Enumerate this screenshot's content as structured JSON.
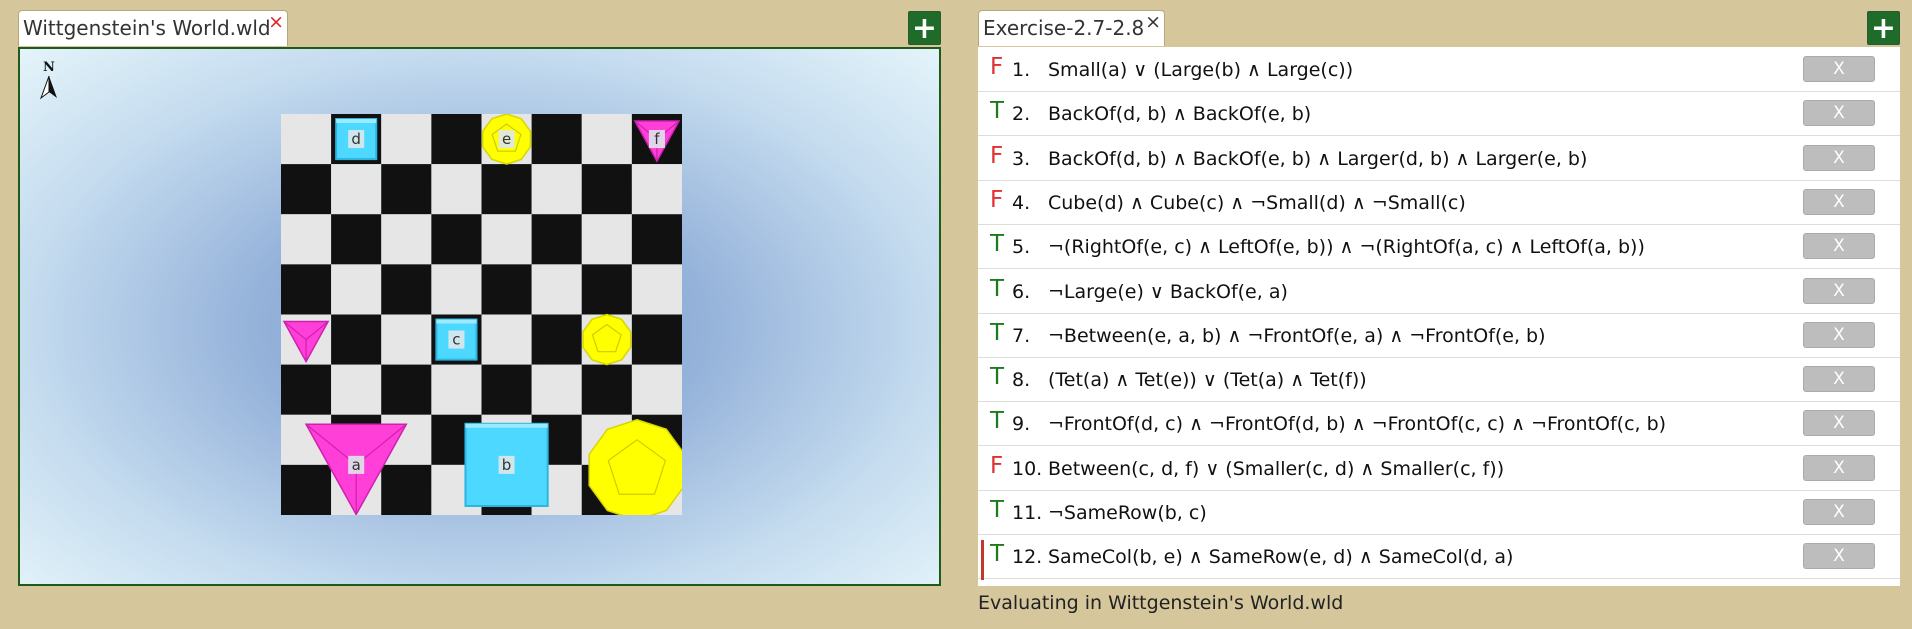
{
  "world_tab": {
    "title": "Wittgenstein's World.wld",
    "close": "×"
  },
  "sentences_tab": {
    "title": "Exercise-2.7-2.8",
    "close": "×"
  },
  "add_label": "+",
  "compass_label": "N",
  "world": {
    "grid_size": 8,
    "objects": [
      {
        "name": "d",
        "shape": "cube",
        "size": "small",
        "col": 1,
        "row": 0
      },
      {
        "name": "e",
        "shape": "dodec",
        "size": "small",
        "col": 4,
        "row": 0
      },
      {
        "name": "f",
        "shape": "tet",
        "size": "small",
        "col": 7,
        "row": 0
      },
      {
        "name": "",
        "shape": "tet",
        "size": "small",
        "col": 0,
        "row": 4
      },
      {
        "name": "c",
        "shape": "cube",
        "size": "small",
        "col": 3,
        "row": 4
      },
      {
        "name": "",
        "shape": "dodec",
        "size": "small",
        "col": 6,
        "row": 4
      },
      {
        "name": "a",
        "shape": "tet",
        "size": "large",
        "col": 1,
        "row": 6
      },
      {
        "name": "b",
        "shape": "cube",
        "size": "large",
        "col": 4,
        "row": 6
      },
      {
        "name": "",
        "shape": "dodec",
        "size": "large",
        "col": 7,
        "row": 6
      }
    ]
  },
  "sentences": [
    {
      "tv": "F",
      "num": "1.",
      "formula": "Small(a) ∨ (Large(b) ∧ Large(c))",
      "btn": "X"
    },
    {
      "tv": "T",
      "num": "2.",
      "formula": "BackOf(d, b) ∧ BackOf(e, b)",
      "btn": "X"
    },
    {
      "tv": "F",
      "num": "3.",
      "formula": "BackOf(d, b) ∧ BackOf(e, b) ∧ Larger(d, b) ∧ Larger(e, b)",
      "btn": "X"
    },
    {
      "tv": "F",
      "num": "4.",
      "formula": "Cube(d) ∧ Cube(c) ∧ ¬Small(d) ∧ ¬Small(c)",
      "btn": "X"
    },
    {
      "tv": "T",
      "num": "5.",
      "formula": "¬(RightOf(e, c) ∧ LeftOf(e, b)) ∧ ¬(RightOf(a, c) ∧ LeftOf(a, b))",
      "btn": "X"
    },
    {
      "tv": "T",
      "num": "6.",
      "formula": "¬Large(e) ∨ BackOf(e, a)",
      "btn": "X"
    },
    {
      "tv": "T",
      "num": "7.",
      "formula": "¬Between(e, a, b) ∧ ¬FrontOf(e, a) ∧ ¬FrontOf(e, b)",
      "btn": "X"
    },
    {
      "tv": "T",
      "num": "8.",
      "formula": "(Tet(a) ∧ Tet(e)) ∨ (Tet(a) ∧ Tet(f))",
      "btn": "X"
    },
    {
      "tv": "T",
      "num": "9.",
      "formula": "¬FrontOf(d, c) ∧ ¬FrontOf(d, b) ∧ ¬FrontOf(c, c) ∧ ¬FrontOf(c, b)",
      "btn": "X"
    },
    {
      "tv": "F",
      "num": "10.",
      "formula": "Between(c, d, f) ∨ (Smaller(c, d) ∧ Smaller(c, f))",
      "btn": "X"
    },
    {
      "tv": "T",
      "num": "11.",
      "formula": "¬SameRow(b, c)",
      "btn": "X"
    },
    {
      "tv": "T",
      "num": "12.",
      "formula": "SameCol(b, e) ∧ SameRow(e, d) ∧ SameCol(d, a)",
      "btn": "X"
    }
  ],
  "status": "Evaluating in Wittgenstein's World.wld",
  "colors": {
    "cube": "#4dd9ff",
    "dodec": "#ffff00",
    "tet": "#ff3fd8",
    "dark_square": "#111111",
    "light_square": "#e6e6e6"
  }
}
